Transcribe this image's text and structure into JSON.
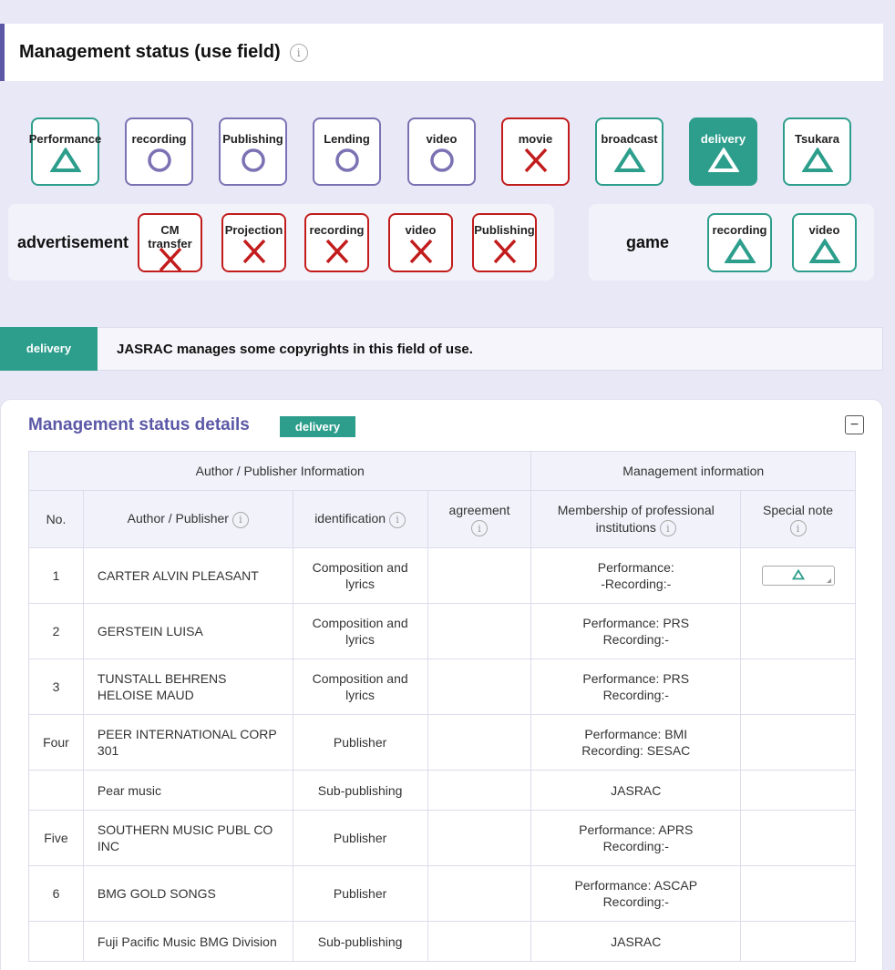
{
  "header": {
    "title": "Management status (use field)"
  },
  "fields": [
    {
      "label": "Performance",
      "symbol": "triangle"
    },
    {
      "label": "recording",
      "symbol": "circle"
    },
    {
      "label": "Publishing",
      "symbol": "circle"
    },
    {
      "label": "Lending",
      "symbol": "circle"
    },
    {
      "label": "video",
      "symbol": "circle"
    },
    {
      "label": "movie",
      "symbol": "cross"
    },
    {
      "label": "broadcast",
      "symbol": "triangle"
    },
    {
      "label": "delivery",
      "symbol": "triangle",
      "selected": true
    },
    {
      "label": "Tsukara",
      "symbol": "triangle"
    }
  ],
  "advertisement": {
    "label": "advertisement",
    "items": [
      {
        "label": "CM\ntransfer",
        "symbol": "cross"
      },
      {
        "label": "Projection",
        "symbol": "cross"
      },
      {
        "label": "recording",
        "symbol": "cross"
      },
      {
        "label": "video",
        "symbol": "cross"
      },
      {
        "label": "Publishing",
        "symbol": "cross"
      }
    ]
  },
  "game": {
    "label": "game",
    "items": [
      {
        "label": "recording",
        "symbol": "triangle"
      },
      {
        "label": "video",
        "symbol": "triangle"
      }
    ]
  },
  "banner": {
    "tag": "delivery",
    "text": "JASRAC manages some copyrights in this field of use."
  },
  "details": {
    "title": "Management status details",
    "tag": "delivery",
    "collapse": "−",
    "group_headers": [
      "Author / Publisher Information",
      "Management information"
    ],
    "columns": [
      "No.",
      "Author / Publisher",
      "identification",
      "agreement",
      "Membership of professional institutions",
      "Special note"
    ],
    "rows": [
      {
        "no": "1",
        "name": "CARTER ALVIN PLEASANT",
        "ident": "Composition and lyrics",
        "agreement": "",
        "membership": "Performance:\n-Recording:-",
        "note": "triangle"
      },
      {
        "no": "2",
        "name": "GERSTEIN LUISA",
        "ident": "Composition and lyrics",
        "agreement": "",
        "membership": "Performance: PRS\nRecording:-",
        "note": ""
      },
      {
        "no": "3",
        "name": "TUNSTALL BEHRENS\nHELOISE MAUD",
        "ident": "Composition and lyrics",
        "agreement": "",
        "membership": "Performance: PRS\nRecording:-",
        "note": ""
      },
      {
        "no": "Four",
        "name": "PEER INTERNATIONAL CORP\n301",
        "ident": "Publisher",
        "agreement": "",
        "membership": "Performance: BMI\nRecording: SESAC",
        "note": ""
      },
      {
        "no": "",
        "name": "Pear music",
        "ident": "Sub-publishing",
        "agreement": "",
        "membership": "JASRAC",
        "note": ""
      },
      {
        "no": "Five",
        "name": "SOUTHERN MUSIC PUBL CO\nINC",
        "ident": "Publisher",
        "agreement": "",
        "membership": "Performance: APRS\nRecording:-",
        "note": ""
      },
      {
        "no": "6",
        "name": "BMG GOLD SONGS",
        "ident": "Publisher",
        "agreement": "",
        "membership": "Performance: ASCAP\nRecording:-",
        "note": ""
      },
      {
        "no": "",
        "name": "Fuji Pacific Music BMG Division",
        "ident": "Sub-publishing",
        "agreement": "",
        "membership": "JASRAC",
        "note": ""
      }
    ]
  },
  "colors": {
    "accent": "#5b58a6",
    "teal": "#2e9e8c",
    "red": "#c21c1c",
    "purple": "#7b72b4"
  }
}
